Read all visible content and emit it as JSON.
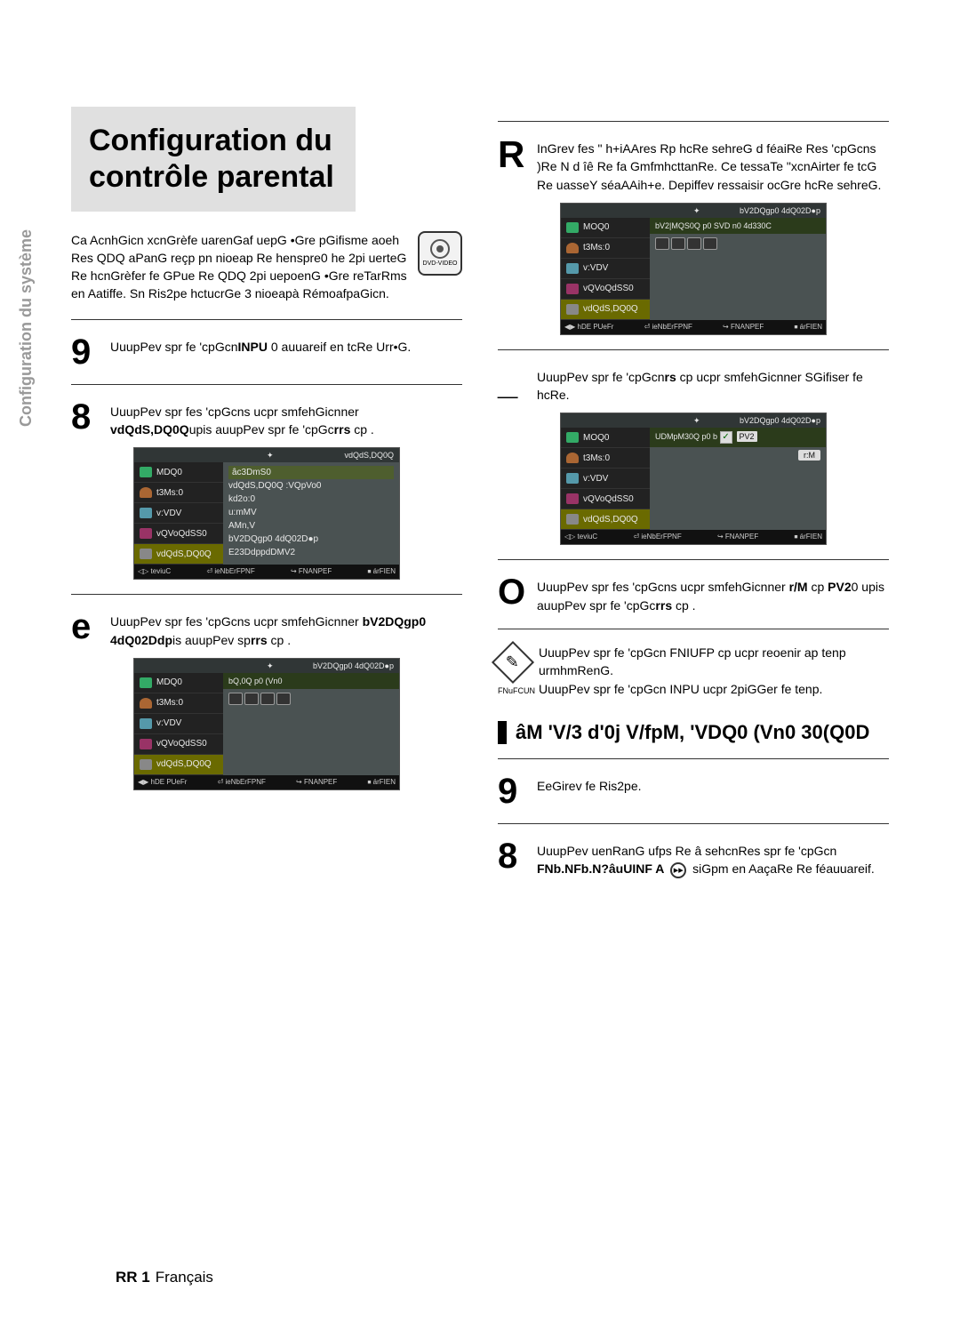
{
  "title": "Configuration du contrôle parental",
  "side_tab": "Configuration du\nsystème",
  "intro": "Ca AcnhGicn xcnGrèfe uarenGaf uepG •Gre pGifisme aoeh Res QDQ aPanG reçp pn nioeap Re henspre0 he 2pi uerteG Re hcnGrèfer fe GPue Re QDQ 2pi uepoenG •Gre reTarRms en Aatiffe. Sn Ris2pe hctucrGe 3 nioeapà RémoafpaGicn.",
  "dvd_badge": "DVD-VIDEO",
  "left_steps": {
    "s1": {
      "num": "9",
      "t1": "UuupPev spr fe 'cpGcn",
      "b1": "INPU",
      "t2": " 0 auuareif en tcRe Urr•G."
    },
    "s2": {
      "num": "8",
      "t1": "UuupPev spr fes 'cpGcns      ucpr smfehGicnner ",
      "b1": "vdQdS,DQ0Q",
      "t2": "upis auupPev spr fe 'cpGc",
      "b2": "rrs",
      "t3": "  cp     ."
    },
    "s3": {
      "num": "e",
      "t1": "UuupPev spr fes 'cpGcns      ucpr smfehGicnner ",
      "b1": "bV2DQgp0 4dQ02Ddp",
      "t2": "is auupPev sp",
      "b2": "rrs",
      "t3": "  cp     ."
    }
  },
  "right_steps": {
    "r1": {
      "num": "R",
      "t": "InGrev fes \" h+iAAres Rp hcRe sehreG d féaiRe Res 'cpGcns )Re N d îê Re fa GmfmhcttanRe. Ce tessaTe \"xcnAirter fe tcG Re uasseY séaAAih+e. Depiffev ressaisir ocGre hcRe sehreG."
    },
    "r2": {
      "num": "_",
      "t1": "UuupPev spr fe 'cpGcn",
      "b1": "rs",
      "t2": "  cp      ucpr smfehGicnner SGifiser fe hcRe."
    },
    "r3": {
      "num": "O",
      "t1": "UuupPev spr fes 'cpGcns       ucpr smfehGicnner ",
      "b1": "r/M",
      "t2": " cp ",
      "b2": "PV2",
      "t3": "0 upis auupPev spr fe 'cpGc",
      "b3": "rrs",
      "t4": "  cp     ."
    }
  },
  "note": {
    "label": "FNuFCUN",
    "l1a": "UuupPev spr fe 'cpGcn",
    "l1b": "FNIUFP",
    "l1c": "  cp       ucpr reoenir ap tenp urmhmRenG.",
    "l2a": "UuupPev spr fe 'cpGcn",
    "l2b": "INPU",
    "l2c": "  ucpr 2piGGer fe tenp."
  },
  "subhead": "âM 'V/3 d'0j V/fpM, 'VDQ0 (Vn0 30(Q0D",
  "bottom_steps": {
    "b1": {
      "num": "9",
      "t": "EeGirev fe Ris2pe."
    },
    "b2": {
      "num": "8",
      "t1": "UuupPev uenRanG ufps Re â sehcnRes spr fe 'cpGcn ",
      "b1": "FNb.NFb.N?âuUINF A",
      "t2": "    siGpm en AaçaRe Re féauuareif."
    }
  },
  "ui1": {
    "head": "vdQdS,DQ0Q",
    "side": [
      "MDQ0",
      "t3Ms:0",
      "v:VDV",
      "vQVoQdSS0",
      "vdQdS,DQ0Q"
    ],
    "main": [
      "âc3DmS0",
      "vdQdS,DQ0Q :VQpVo0",
      "kd2o:0",
      "u:mMV",
      "AMn,V",
      "bV2DQgp0 4dQ02D●p",
      "E23DdppdDMV2"
    ],
    "main_sel": 0,
    "foot": [
      "◁▷ teviuC",
      "⏎ ieNbErFPNF",
      "↪ FNANPEF",
      "⏹ árFIEN"
    ]
  },
  "ui2": {
    "head": "bV2DQgp0 4dQ02D●p",
    "side": [
      "MDQ0",
      "t3Ms:0",
      "v:VDV",
      "vQVoQdSS0",
      "vdQdS,DQ0Q"
    ],
    "highlight": "bQ,0Q p0 (Vn0",
    "foot": [
      "◀▶ hDE PUeFr",
      "⏎ ieNbErFPNF",
      "↪ FNANPEF",
      "⏹ árFIEN"
    ]
  },
  "ui3": {
    "head": "bV2DQgp0 4dQ02D●p",
    "side": [
      "MOQ0",
      "t3Ms:0",
      "v:VDV",
      "vQVoQdSS0",
      "vdQdS,DQ0Q"
    ],
    "highlight": "bV2|MQS0Q p0 SVD n0 4d330C",
    "foot": [
      "◀▶ hDE PUeFr",
      "⏎ ieNbErFPNF",
      "↪ FNANPEF",
      "⏹ árFIEN"
    ]
  },
  "ui4": {
    "head": "bV2DQgp0 4dQ02D●p",
    "side": [
      "MOQ0",
      "t3Ms:0",
      "v:VDV",
      "vQVoQdSS0",
      "vdQdS,DQ0Q"
    ],
    "highlight": "UDMpM30Q p0 b",
    "passopt": "PV2",
    "ok": "r:M",
    "foot": [
      "◁▷ teviuC",
      "⏎ ieNbErFPNF",
      "↪ FNANPEF",
      "⏹ árFIEN"
    ]
  },
  "footer": {
    "page": "RR 1",
    "lang": "Français"
  }
}
